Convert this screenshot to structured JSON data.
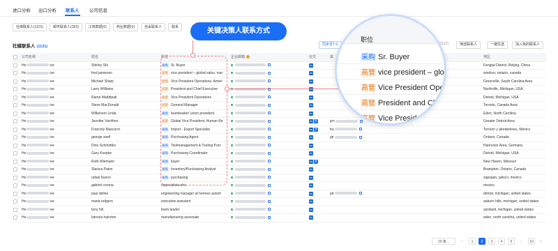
{
  "tabs": [
    {
      "label": "进口分析"
    },
    {
      "label": "出口分析"
    },
    {
      "label": "联系人"
    },
    {
      "label": "公司信息"
    }
  ],
  "filters": [
    {
      "label": "社媒联系人(1101)"
    },
    {
      "label": "邮件联系人(283)"
    },
    {
      "label": "工商数据(0)"
    },
    {
      "label": "商业数据(0)"
    },
    {
      "label": "自采联系人"
    },
    {
      "label": "联系"
    }
  ],
  "section": {
    "title": "社媒联系人",
    "count": "(1131)"
  },
  "toolbar": {
    "sync_label": "同步至T-C",
    "count_label": "(1122)",
    "filter_label": "筛选联系人",
    "one_click_label": "一键优选",
    "add_label": "加入我的联系人"
  },
  "callout": "关键决策人联系方式",
  "columns": {
    "company": "公司名称",
    "name": "姓名",
    "title": "职位",
    "email": "企业邮箱",
    "social": "社交",
    "extra": "其",
    "region": "地区"
  },
  "rows": [
    {
      "company_a": "He",
      "company_b": "ive",
      "name": "Shirley Shi",
      "tag": "采购",
      "title": "Sr. Buyer",
      "social": [
        "in"
      ],
      "region": "Fengtai District, Beijing, China"
    },
    {
      "company_a": "He",
      "company_b": "ive",
      "name": "fred jamieson",
      "tag": "高管",
      "title": "vice president – global sales, mar",
      "social": [
        "in"
      ],
      "region": "windsor, ontario, canada"
    },
    {
      "company_a": "He",
      "company_b": "ive",
      "name": "Michael Sharp",
      "tag": "高管",
      "title": "Vice President Operations, Ameri",
      "social": [
        "in"
      ],
      "region": "Greenville, South Carolina Area"
    },
    {
      "company_a": "He",
      "company_b": "ive",
      "name": "Larry Williams",
      "tag": "高管",
      "title": "President and Chief Executive",
      "social": [
        "in"
      ],
      "region": "Northville, Michigan, USA"
    },
    {
      "company_a": "He",
      "company_b": "ive",
      "name": "Rama Maddipati",
      "tag": "高管",
      "title": "Vice President Operations",
      "social": [
        "in"
      ],
      "region": "Detroit, Michigan, USA"
    },
    {
      "company_a": "He",
      "company_b": "ive",
      "name": "Steve MacDonald",
      "tag": "高管",
      "title": "General Manager",
      "social": [
        "in"
      ],
      "region": "Toronto, Canada Area"
    },
    {
      "company_a": "He",
      "company_b": "ive",
      "name": "Wilkerson Linda",
      "tag": "采购",
      "title": "teamleader/ union president",
      "social": [
        "in"
      ],
      "region": "Eden, North Carolina"
    },
    {
      "company_a": "He",
      "company_b": "ive",
      "name": "Jennifer VanHorn",
      "tag": "高管",
      "title": "Global Vice President, Human Re",
      "social": [
        "in",
        "f"
      ],
      "extra": "jen",
      "region": "Greater Detroit Area"
    },
    {
      "company_a": "He",
      "company_b": "ive",
      "name": "Francely Mascorro",
      "tag": "采购",
      "title": "Import - Export Specialist",
      "social": [
        "in",
        "f"
      ],
      "extra": "fra",
      "region": "Torreón y alrededores, México"
    },
    {
      "company_a": "He",
      "company_b": "ive",
      "name": "george snell",
      "tag": "采购",
      "title": "Purchasing Agent",
      "social": [
        "in"
      ],
      "extra": "ge",
      "region": "Ontario, Canada"
    },
    {
      "company_a": "He",
      "company_b": "ive",
      "name": "Dino Schmidtko",
      "tag": "采购",
      "title": "Toolmanagement & Tooling Purc",
      "social": [
        "in"
      ],
      "region": "Hannover Area, Germany"
    },
    {
      "company_a": "He",
      "company_b": "ive",
      "name": "Gary Koepke",
      "tag": "采购",
      "title": "Purchasing Coordinator",
      "social": [
        "in"
      ],
      "region": "Detroit, Michigan, USA"
    },
    {
      "company_a": "He",
      "company_b": "ive",
      "name": "Ruth Wiemann",
      "tag": "采购",
      "title": "buyer",
      "social": [
        "in",
        "f"
      ],
      "region": "New Haven, Missouri"
    },
    {
      "company_a": "He",
      "company_b": "ive",
      "name": "Slavica Paton",
      "tag": "采购",
      "title": "Inventory/Purchasing Analyst",
      "social": [
        "in"
      ],
      "region": "Brampton, Ontario, Canada"
    },
    {
      "company_a": "He",
      "company_b": "ive",
      "name": "rafael bueno",
      "tag": "采购",
      "title": "purchasing",
      "social": [
        "in"
      ],
      "region": "zapopan, jalisco, mexico"
    },
    {
      "company_a": "He",
      "company_b": "ive",
      "name": "gabriel corona",
      "tag": "",
      "title": "especialista ehs",
      "social": [
        "in"
      ],
      "region": "mexico"
    },
    {
      "company_a": "He",
      "company_b": "ive",
      "name": "paul deline",
      "tag": "",
      "title": "engineering manager at hennes autom",
      "social": [
        "in"
      ],
      "extra": "pd",
      "region": "detroit, michigan, united states"
    },
    {
      "company_a": "He",
      "company_b": "ive",
      "name": "maria rodgers",
      "tag": "",
      "title": "executive assistant",
      "social": [
        "in"
      ],
      "region": "auburn hills, michigan, united states"
    },
    {
      "company_a": "He",
      "company_b": "ive",
      "name": "tony hill",
      "tag": "",
      "title": "team leader",
      "social": [
        "in"
      ],
      "region": "ypsilanti, michigan, united states"
    },
    {
      "company_a": "He",
      "company_b": "ive",
      "name": "latrevia hairston",
      "tag": "",
      "title": "manufacturing associate",
      "social": [
        "in"
      ],
      "region": "eden, north carolina, united states"
    }
  ],
  "magnifier": {
    "header": "职位",
    "rows": [
      {
        "tag": "采购",
        "title": "Sr. Buyer"
      },
      {
        "tag": "高管",
        "title": "vice president – global"
      },
      {
        "tag": "高管",
        "title": "Vice President Operatio"
      },
      {
        "tag": "高管",
        "title": "President and Chief"
      },
      {
        "tag": "高管",
        "title": "Vice President S"
      }
    ]
  },
  "pagination": {
    "page_size": "20 条...",
    "prev": "‹",
    "pages": [
      "1",
      "2",
      "3",
      "4",
      "5"
    ],
    "ellipsis": "...",
    "last": "10",
    "next": "›",
    "current": "2"
  },
  "colors": {
    "accent": "#1a6ef5",
    "manager_tag": "#e57d1f",
    "buyer_tag": "#1a6ef5",
    "highlight": "#f08080"
  }
}
